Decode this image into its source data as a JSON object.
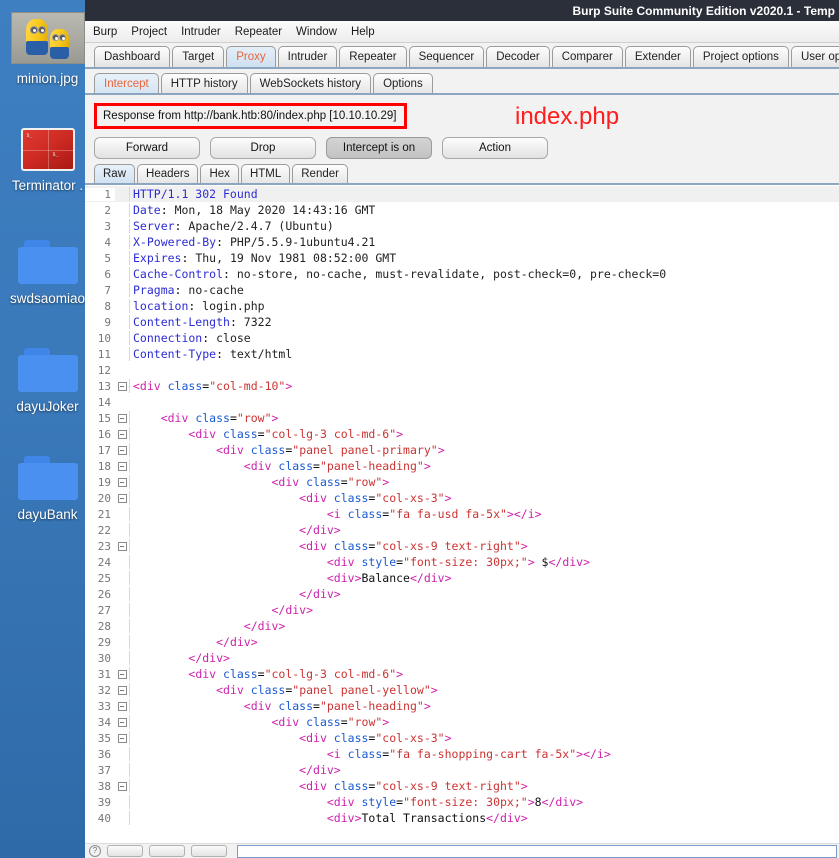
{
  "desktop": {
    "icons": [
      {
        "name": "minion.jpg",
        "type": "image-thumbnail"
      },
      {
        "name": "Terminator .",
        "type": "terminal-thumbnail"
      },
      {
        "name": "swdsaomiao",
        "type": "folder"
      },
      {
        "name": "dayuJoker",
        "type": "folder"
      },
      {
        "name": "dayuBank",
        "type": "folder"
      }
    ]
  },
  "window": {
    "title": "Burp Suite Community Edition v2020.1 - Temp",
    "menu": [
      "Burp",
      "Project",
      "Intruder",
      "Repeater",
      "Window",
      "Help"
    ],
    "accent_selected_tab_color": "#e8653c",
    "annotation_color": "#ff1d1d",
    "highlight_box_color": "#ff0000"
  },
  "main_tabs": {
    "selected": "Proxy",
    "items": [
      "Dashboard",
      "Target",
      "Proxy",
      "Intruder",
      "Repeater",
      "Sequencer",
      "Decoder",
      "Comparer",
      "Extender",
      "Project options",
      "User options"
    ]
  },
  "sub_tabs": {
    "selected": "Intercept",
    "items": [
      "Intercept",
      "HTTP history",
      "WebSockets history",
      "Options"
    ]
  },
  "response": {
    "bar_text": "Response from http://bank.htb:80/index.php  [10.10.10.29]",
    "annotation": "index.php"
  },
  "actions": {
    "forward": "Forward",
    "drop": "Drop",
    "intercept": "Intercept is on",
    "action": "Action"
  },
  "view_tabs": {
    "selected": "Raw",
    "items": [
      "Raw",
      "Headers",
      "Hex",
      "HTML",
      "Render"
    ]
  },
  "editor": {
    "lines": [
      {
        "n": 1,
        "fold": false,
        "segs": [
          [
            "k-hdr",
            "HTTP/1.1 302 Found"
          ]
        ]
      },
      {
        "n": 2,
        "fold": false,
        "segs": [
          [
            "k-hdr",
            "Date"
          ],
          [
            "k-plain",
            ": "
          ],
          [
            "k-txt",
            "Mon, 18 May 2020 14:43:16 GMT"
          ]
        ]
      },
      {
        "n": 3,
        "fold": false,
        "segs": [
          [
            "k-hdr",
            "Server"
          ],
          [
            "k-plain",
            ": "
          ],
          [
            "k-txt",
            "Apache/2.4.7 (Ubuntu)"
          ]
        ]
      },
      {
        "n": 4,
        "fold": false,
        "segs": [
          [
            "k-hdr",
            "X-Powered-By"
          ],
          [
            "k-plain",
            ": "
          ],
          [
            "k-txt",
            "PHP/5.5.9-1ubuntu4.21"
          ]
        ]
      },
      {
        "n": 5,
        "fold": false,
        "segs": [
          [
            "k-hdr",
            "Expires"
          ],
          [
            "k-plain",
            ": "
          ],
          [
            "k-txt",
            "Thu, 19 Nov 1981 08:52:00 GMT"
          ]
        ]
      },
      {
        "n": 6,
        "fold": false,
        "segs": [
          [
            "k-hdr",
            "Cache-Control"
          ],
          [
            "k-plain",
            ": "
          ],
          [
            "k-txt",
            "no-store, no-cache, must-revalidate, post-check=0, pre-check=0"
          ]
        ]
      },
      {
        "n": 7,
        "fold": false,
        "segs": [
          [
            "k-hdr",
            "Pragma"
          ],
          [
            "k-plain",
            ": "
          ],
          [
            "k-txt",
            "no-cache"
          ]
        ]
      },
      {
        "n": 8,
        "fold": false,
        "segs": [
          [
            "k-hdr",
            "location"
          ],
          [
            "k-plain",
            ": "
          ],
          [
            "k-txt",
            "login.php"
          ]
        ]
      },
      {
        "n": 9,
        "fold": false,
        "segs": [
          [
            "k-hdr",
            "Content-Length"
          ],
          [
            "k-plain",
            ": "
          ],
          [
            "k-txt",
            "7322"
          ]
        ]
      },
      {
        "n": 10,
        "fold": false,
        "segs": [
          [
            "k-hdr",
            "Connection"
          ],
          [
            "k-plain",
            ": "
          ],
          [
            "k-txt",
            "close"
          ]
        ]
      },
      {
        "n": 11,
        "fold": false,
        "segs": [
          [
            "k-hdr",
            "Content-Type"
          ],
          [
            "k-plain",
            ": "
          ],
          [
            "k-txt",
            "text/html"
          ]
        ]
      },
      {
        "n": 12,
        "fold": false,
        "segs": [
          [
            "k-plain",
            ""
          ]
        ]
      },
      {
        "n": 13,
        "fold": true,
        "segs": [
          [
            "k-tag",
            "<div "
          ],
          [
            "k-attr",
            "class"
          ],
          [
            "k-plain",
            "="
          ],
          [
            "k-val",
            "\"col-md-10\""
          ],
          [
            "k-tag",
            ">"
          ]
        ]
      },
      {
        "n": 14,
        "fold": false,
        "segs": [
          [
            "k-plain",
            ""
          ]
        ]
      },
      {
        "n": 15,
        "fold": true,
        "segs": [
          [
            "k-plain",
            "    "
          ],
          [
            "k-tag",
            "<div "
          ],
          [
            "k-attr",
            "class"
          ],
          [
            "k-plain",
            "="
          ],
          [
            "k-val",
            "\"row\""
          ],
          [
            "k-tag",
            ">"
          ]
        ]
      },
      {
        "n": 16,
        "fold": true,
        "segs": [
          [
            "k-plain",
            "        "
          ],
          [
            "k-tag",
            "<div "
          ],
          [
            "k-attr",
            "class"
          ],
          [
            "k-plain",
            "="
          ],
          [
            "k-val",
            "\"col-lg-3 col-md-6\""
          ],
          [
            "k-tag",
            ">"
          ]
        ]
      },
      {
        "n": 17,
        "fold": true,
        "segs": [
          [
            "k-plain",
            "            "
          ],
          [
            "k-tag",
            "<div "
          ],
          [
            "k-attr",
            "class"
          ],
          [
            "k-plain",
            "="
          ],
          [
            "k-val",
            "\"panel panel-primary\""
          ],
          [
            "k-tag",
            ">"
          ]
        ]
      },
      {
        "n": 18,
        "fold": true,
        "segs": [
          [
            "k-plain",
            "                "
          ],
          [
            "k-tag",
            "<div "
          ],
          [
            "k-attr",
            "class"
          ],
          [
            "k-plain",
            "="
          ],
          [
            "k-val",
            "\"panel-heading\""
          ],
          [
            "k-tag",
            ">"
          ]
        ]
      },
      {
        "n": 19,
        "fold": true,
        "segs": [
          [
            "k-plain",
            "                    "
          ],
          [
            "k-tag",
            "<div "
          ],
          [
            "k-attr",
            "class"
          ],
          [
            "k-plain",
            "="
          ],
          [
            "k-val",
            "\"row\""
          ],
          [
            "k-tag",
            ">"
          ]
        ]
      },
      {
        "n": 20,
        "fold": true,
        "segs": [
          [
            "k-plain",
            "                        "
          ],
          [
            "k-tag",
            "<div "
          ],
          [
            "k-attr",
            "class"
          ],
          [
            "k-plain",
            "="
          ],
          [
            "k-val",
            "\"col-xs-3\""
          ],
          [
            "k-tag",
            ">"
          ]
        ]
      },
      {
        "n": 21,
        "fold": false,
        "segs": [
          [
            "k-plain",
            "                            "
          ],
          [
            "k-tag",
            "<i "
          ],
          [
            "k-attr",
            "class"
          ],
          [
            "k-plain",
            "="
          ],
          [
            "k-val",
            "\"fa fa-usd fa-5x\""
          ],
          [
            "k-tag",
            "></i>"
          ]
        ]
      },
      {
        "n": 22,
        "fold": false,
        "segs": [
          [
            "k-plain",
            "                        "
          ],
          [
            "k-tag",
            "</div>"
          ]
        ]
      },
      {
        "n": 23,
        "fold": true,
        "segs": [
          [
            "k-plain",
            "                        "
          ],
          [
            "k-tag",
            "<div "
          ],
          [
            "k-attr",
            "class"
          ],
          [
            "k-plain",
            "="
          ],
          [
            "k-val",
            "\"col-xs-9 text-right\""
          ],
          [
            "k-tag",
            ">"
          ]
        ]
      },
      {
        "n": 24,
        "fold": false,
        "segs": [
          [
            "k-plain",
            "                            "
          ],
          [
            "k-tag",
            "<div "
          ],
          [
            "k-attr",
            "style"
          ],
          [
            "k-plain",
            "="
          ],
          [
            "k-val",
            "\"font-size: 30px;\""
          ],
          [
            "k-tag",
            ">"
          ],
          [
            "k-plain",
            " $"
          ],
          [
            "k-tag",
            "</div>"
          ]
        ]
      },
      {
        "n": 25,
        "fold": false,
        "segs": [
          [
            "k-plain",
            "                            "
          ],
          [
            "k-tag",
            "<div>"
          ],
          [
            "k-plain",
            "Balance"
          ],
          [
            "k-tag",
            "</div>"
          ]
        ]
      },
      {
        "n": 26,
        "fold": false,
        "segs": [
          [
            "k-plain",
            "                        "
          ],
          [
            "k-tag",
            "</div>"
          ]
        ]
      },
      {
        "n": 27,
        "fold": false,
        "segs": [
          [
            "k-plain",
            "                    "
          ],
          [
            "k-tag",
            "</div>"
          ]
        ]
      },
      {
        "n": 28,
        "fold": false,
        "segs": [
          [
            "k-plain",
            "                "
          ],
          [
            "k-tag",
            "</div>"
          ]
        ]
      },
      {
        "n": 29,
        "fold": false,
        "segs": [
          [
            "k-plain",
            "            "
          ],
          [
            "k-tag",
            "</div>"
          ]
        ]
      },
      {
        "n": 30,
        "fold": false,
        "segs": [
          [
            "k-plain",
            "        "
          ],
          [
            "k-tag",
            "</div>"
          ]
        ]
      },
      {
        "n": 31,
        "fold": true,
        "segs": [
          [
            "k-plain",
            "        "
          ],
          [
            "k-tag",
            "<div "
          ],
          [
            "k-attr",
            "class"
          ],
          [
            "k-plain",
            "="
          ],
          [
            "k-val",
            "\"col-lg-3 col-md-6\""
          ],
          [
            "k-tag",
            ">"
          ]
        ]
      },
      {
        "n": 32,
        "fold": true,
        "segs": [
          [
            "k-plain",
            "            "
          ],
          [
            "k-tag",
            "<div "
          ],
          [
            "k-attr",
            "class"
          ],
          [
            "k-plain",
            "="
          ],
          [
            "k-val",
            "\"panel panel-yellow\""
          ],
          [
            "k-tag",
            ">"
          ]
        ]
      },
      {
        "n": 33,
        "fold": true,
        "segs": [
          [
            "k-plain",
            "                "
          ],
          [
            "k-tag",
            "<div "
          ],
          [
            "k-attr",
            "class"
          ],
          [
            "k-plain",
            "="
          ],
          [
            "k-val",
            "\"panel-heading\""
          ],
          [
            "k-tag",
            ">"
          ]
        ]
      },
      {
        "n": 34,
        "fold": true,
        "segs": [
          [
            "k-plain",
            "                    "
          ],
          [
            "k-tag",
            "<div "
          ],
          [
            "k-attr",
            "class"
          ],
          [
            "k-plain",
            "="
          ],
          [
            "k-val",
            "\"row\""
          ],
          [
            "k-tag",
            ">"
          ]
        ]
      },
      {
        "n": 35,
        "fold": true,
        "segs": [
          [
            "k-plain",
            "                        "
          ],
          [
            "k-tag",
            "<div "
          ],
          [
            "k-attr",
            "class"
          ],
          [
            "k-plain",
            "="
          ],
          [
            "k-val",
            "\"col-xs-3\""
          ],
          [
            "k-tag",
            ">"
          ]
        ]
      },
      {
        "n": 36,
        "fold": false,
        "segs": [
          [
            "k-plain",
            "                            "
          ],
          [
            "k-tag",
            "<i "
          ],
          [
            "k-attr",
            "class"
          ],
          [
            "k-plain",
            "="
          ],
          [
            "k-val",
            "\"fa fa-shopping-cart fa-5x\""
          ],
          [
            "k-tag",
            "></i>"
          ]
        ]
      },
      {
        "n": 37,
        "fold": false,
        "segs": [
          [
            "k-plain",
            "                        "
          ],
          [
            "k-tag",
            "</div>"
          ]
        ]
      },
      {
        "n": 38,
        "fold": true,
        "segs": [
          [
            "k-plain",
            "                        "
          ],
          [
            "k-tag",
            "<div "
          ],
          [
            "k-attr",
            "class"
          ],
          [
            "k-plain",
            "="
          ],
          [
            "k-val",
            "\"col-xs-9 text-right\""
          ],
          [
            "k-tag",
            ">"
          ]
        ]
      },
      {
        "n": 39,
        "fold": false,
        "segs": [
          [
            "k-plain",
            "                            "
          ],
          [
            "k-tag",
            "<div "
          ],
          [
            "k-attr",
            "style"
          ],
          [
            "k-plain",
            "="
          ],
          [
            "k-val",
            "\"font-size: 30px;\""
          ],
          [
            "k-tag",
            ">"
          ],
          [
            "k-plain",
            "8"
          ],
          [
            "k-tag",
            "</div>"
          ]
        ]
      },
      {
        "n": 40,
        "fold": false,
        "segs": [
          [
            "k-plain",
            "                            "
          ],
          [
            "k-tag",
            "<div>"
          ],
          [
            "k-plain",
            "Total Transactions"
          ],
          [
            "k-tag",
            "</div>"
          ]
        ]
      }
    ]
  },
  "bottom_bar": {
    "search_value": "",
    "search_placeholder": ""
  }
}
